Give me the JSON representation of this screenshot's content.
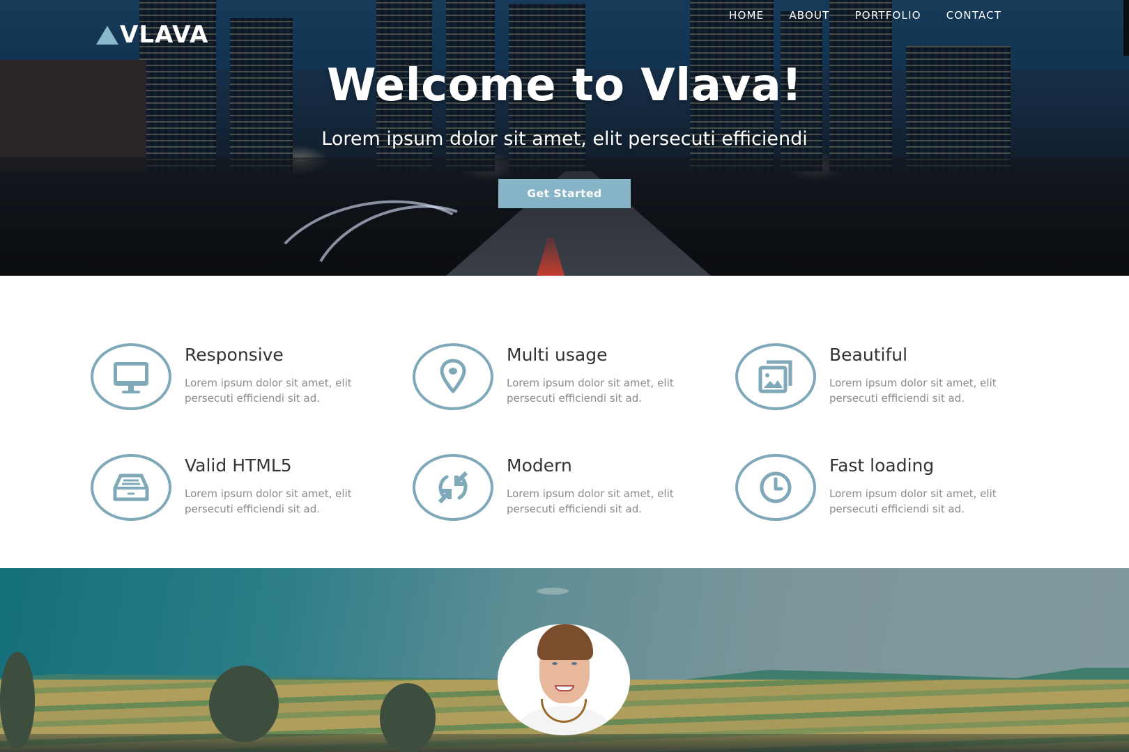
{
  "brand": {
    "name": "VLAVA",
    "logo_icon": "triangle-icon",
    "accent": "#87b4c6"
  },
  "nav": {
    "items": [
      {
        "label": "HOME"
      },
      {
        "label": "ABOUT"
      },
      {
        "label": "PORTFOLIO"
      },
      {
        "label": "CONTACT"
      }
    ]
  },
  "hero": {
    "title": "Welcome to Vlava!",
    "subtitle": "Lorem ipsum dolor sit amet, elit persecuti efficiendi",
    "cta_label": "Get Started",
    "background": "city-night-photo"
  },
  "features": {
    "icon_color": "#7fa9b9",
    "items": [
      {
        "title": "Responsive",
        "text": "Lorem ipsum dolor sit amet, elit persecuti efficiendi sit ad.",
        "icon": "monitor-icon"
      },
      {
        "title": "Multi usage",
        "text": "Lorem ipsum dolor sit amet, elit persecuti efficiendi sit ad.",
        "icon": "map-pin-icon"
      },
      {
        "title": "Beautiful",
        "text": "Lorem ipsum dolor sit amet, elit persecuti efficiendi sit ad.",
        "icon": "image-gallery-icon"
      },
      {
        "title": "Valid HTML5",
        "text": "Lorem ipsum dolor sit amet, elit persecuti efficiendi sit ad.",
        "icon": "inbox-drawer-icon"
      },
      {
        "title": "Modern",
        "text": "Lorem ipsum dolor sit amet, elit persecuti efficiendi sit ad.",
        "icon": "sync-arrows-icon"
      },
      {
        "title": "Fast loading",
        "text": "Lorem ipsum dolor sit amet, elit persecuti efficiendi sit ad.",
        "icon": "clock-icon"
      }
    ]
  },
  "testimonial": {
    "background": "farm-field-photo",
    "avatar": "person-portrait"
  }
}
